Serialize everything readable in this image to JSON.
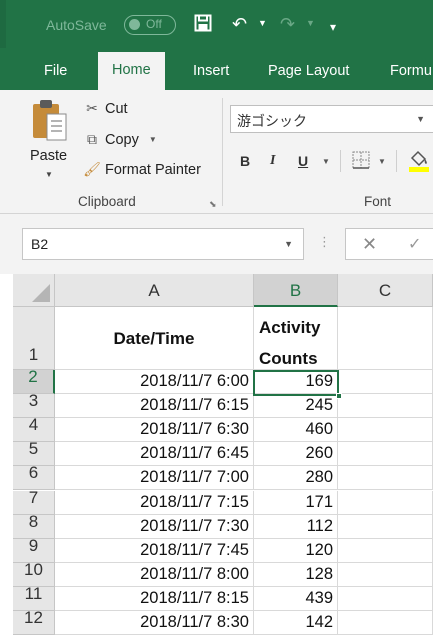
{
  "title_bar": {
    "autosave_label": "AutoSave",
    "autosave_state": "Off"
  },
  "ribbon_tabs": [
    {
      "label": "File"
    },
    {
      "label": "Home"
    },
    {
      "label": "Insert"
    },
    {
      "label": "Page Layout"
    },
    {
      "label": "Formu"
    }
  ],
  "active_tab": "Home",
  "clipboard": {
    "paste_label": "Paste",
    "cut_label": "Cut",
    "copy_label": "Copy",
    "format_painter_label": "Format Painter",
    "group_label": "Clipboard"
  },
  "font_group": {
    "font_name": "游ゴシック",
    "bold_label": "B",
    "italic_label": "I",
    "underline_label": "U",
    "group_label": "Font"
  },
  "formula_bar": {
    "name_box_value": "B2",
    "cancel_symbol": "✕",
    "enter_symbol": "✓"
  },
  "sheet": {
    "columns": [
      "A",
      "B",
      "C"
    ],
    "selected_cell": "B2",
    "header_row": {
      "row_number": "1",
      "a_header": "Date/Time",
      "b_header_line1": "Activity",
      "b_header_line2": "Counts"
    },
    "rows": [
      {
        "row": "2",
        "datetime": "2018/11/7 6:00",
        "count": "169"
      },
      {
        "row": "3",
        "datetime": "2018/11/7 6:15",
        "count": "245"
      },
      {
        "row": "4",
        "datetime": "2018/11/7 6:30",
        "count": "460"
      },
      {
        "row": "5",
        "datetime": "2018/11/7 6:45",
        "count": "260"
      },
      {
        "row": "6",
        "datetime": "2018/11/7 7:00",
        "count": "280"
      },
      {
        "row": "7",
        "datetime": "2018/11/7 7:15",
        "count": "171"
      },
      {
        "row": "8",
        "datetime": "2018/11/7 7:30",
        "count": "112"
      },
      {
        "row": "9",
        "datetime": "2018/11/7 7:45",
        "count": "120"
      },
      {
        "row": "10",
        "datetime": "2018/11/7 8:00",
        "count": "128"
      },
      {
        "row": "11",
        "datetime": "2018/11/7 8:15",
        "count": "439"
      },
      {
        "row": "12",
        "datetime": "2018/11/7 8:30",
        "count": "142"
      }
    ]
  },
  "colors": {
    "excel_green": "#217346",
    "ribbon_bg": "#f3f3f3"
  }
}
